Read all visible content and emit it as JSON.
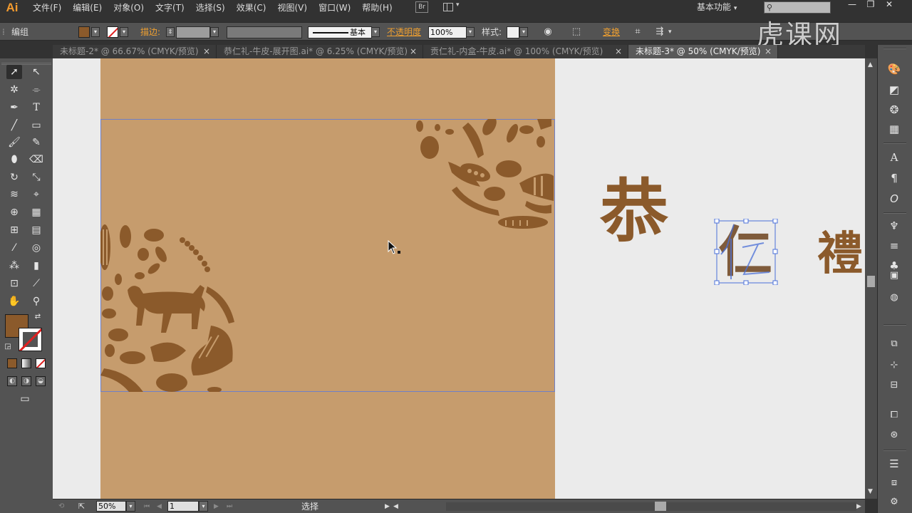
{
  "app": {
    "logo": "Ai"
  },
  "menu": [
    "文件(F)",
    "编辑(E)",
    "对象(O)",
    "文字(T)",
    "选择(S)",
    "效果(C)",
    "视图(V)",
    "窗口(W)",
    "帮助(H)"
  ],
  "bridge_label": "Br",
  "workspace": "基本功能",
  "window_controls": {
    "minimize": "—",
    "restore": "❐",
    "close": "✕"
  },
  "controlbar": {
    "selection": "编组",
    "stroke_label": "描边:",
    "stroke_style": "基本",
    "opacity_label": "不透明度",
    "opacity_value": "100%",
    "style_label": "样式:",
    "transform_label": "变换"
  },
  "watermark": "虎课网",
  "tabs": [
    {
      "label": "未标题-2* @ 66.67% (CMYK/预览)",
      "active": false
    },
    {
      "label": "恭仁礼-牛皮-展开图.ai* @ 6.25% (CMYK/预览)",
      "active": false
    },
    {
      "label": "贡仁礼-内盒-牛皮.ai* @ 100% (CMYK/预览)",
      "active": false
    },
    {
      "label": "未标题-3* @ 50% (CMYK/预览)",
      "active": true
    }
  ],
  "tab_close": "×",
  "canvas": {
    "calligraphy": [
      "恭",
      "仁",
      "禮"
    ]
  },
  "colors": {
    "kraft": "#c69c6d",
    "ink": "#8b5a2b",
    "selection": "#4a6fd8",
    "pasteboard": "#ebebeb",
    "panel": "#535353"
  },
  "statusbar": {
    "zoom": "50%",
    "page": "1",
    "tool_status": "选择"
  }
}
